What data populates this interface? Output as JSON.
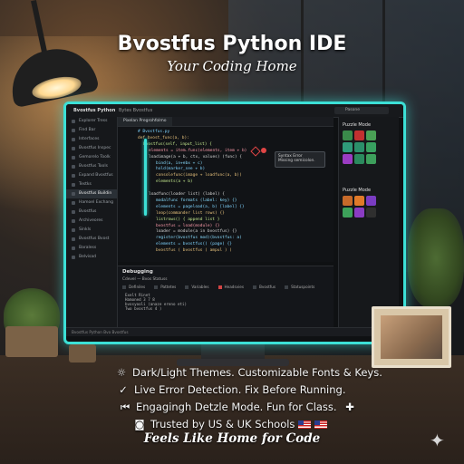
{
  "header": {
    "title": "Bvostfus Python IDE",
    "subtitle": "Your Coding Home"
  },
  "ide": {
    "brand": "Bvostfus Python",
    "menu": "Bytes Bvostfus",
    "search": "Pasone",
    "tab": "Pixelan Pregrohfolmo",
    "sidebar": [
      "Explorer Tress",
      "Find Bar",
      "Interfaces",
      "Bvostfus Inspec",
      "Gemorelo Toolk",
      "Bvostfus Tools",
      "Expand Bvostfus",
      "Testks",
      "Bvostfus Buildin",
      "Hamoel Exchang",
      "Bvostfus",
      "Archiveores",
      "Sinkls",
      "Bvostfus Bvost",
      "Baraless",
      "Belvisad"
    ],
    "active_sidebar_index": 8,
    "code_lines": [
      "# Bvostfus.py",
      "def bvost_func(a, b): ",
      "  bvostfus(self, input_list) {",
      "    elements = item.func(elements, item + b)",
      "    loadimage(a + b, ctx, values) (func) {",
      "      bind(a, in+ebx + c)",
      "      hold(marker_see + b)",
      "      consolefunc(image + loadfunc(a, b))",
      "      elements(a + b)",
      "",
      "    loadfunc(loader list) (label) {",
      "      modalfunc formats (label: key) {}",
      "      elements = pageload(a, b) [label] {}",
      "      loop(commander list rows) {}",
      "      listrows() {  append list }",
      "      bvostfus = load(module) {}",
      "      loader = module(a in bvostfus) {}",
      "      register(bvostfus mod)(bvostfus: a)",
      "      elements = bvostfus() (page) {}",
      "      bvostfus ( bvostfus ( ampul ) )"
    ],
    "error_popup": {
      "title": "Syntax Error",
      "message": "Missing semicolon."
    },
    "puzzle": {
      "label_top": "Puzzle Mode",
      "label_bottom": "Puzzle Mode",
      "tiles_top": [
        "#3a8a4a",
        "#c23030",
        "#4aa055",
        "#2f9b7a",
        "#2b8f6a",
        "#38a060",
        "#9b3cc2",
        "#2b8a5e",
        "#3d9f5c"
      ],
      "tiles_bottom": [
        "#c66a2a",
        "#e07a2a",
        "#7a3cc2",
        "#3da15a",
        "#8a3cc2",
        "#2f2f2f"
      ]
    },
    "debug": {
      "title": "Debugging",
      "subtitle": "Cdevel — Bvos  Statuss",
      "tabs": [
        "Definiles",
        "Pattetes",
        "Variables",
        "Headsvies",
        "Bvostfus",
        "Statuspoints"
      ],
      "lines": [
        "Exelt Rinet",
        "  Hamoned 3 7 8",
        "  bvosyooli (anaze ereno eti)",
        "  Two bvostfus 4 )"
      ]
    },
    "status_bar": "Bvostfus Python  Bvo Bvostfus"
  },
  "features": [
    {
      "icon": "sun-icon",
      "glyph": "☼",
      "text": "Dark/Light Themes. Customizable Fonts & Keys."
    },
    {
      "icon": "check-icon",
      "glyph": "✓",
      "text": "Live Error Detection. Fix Before Running."
    },
    {
      "icon": "puzzle-icon",
      "glyph": "⏮",
      "text": "Engagingh Detzle Mode. Fun for Class."
    },
    {
      "icon": "shield-icon",
      "glyph": "◙",
      "text": "Trusted by US & UK Schools"
    }
  ],
  "tagline": "Feels Like Home for Code",
  "colors": {
    "accent": "#3ce0d6",
    "error": "#e04545"
  }
}
